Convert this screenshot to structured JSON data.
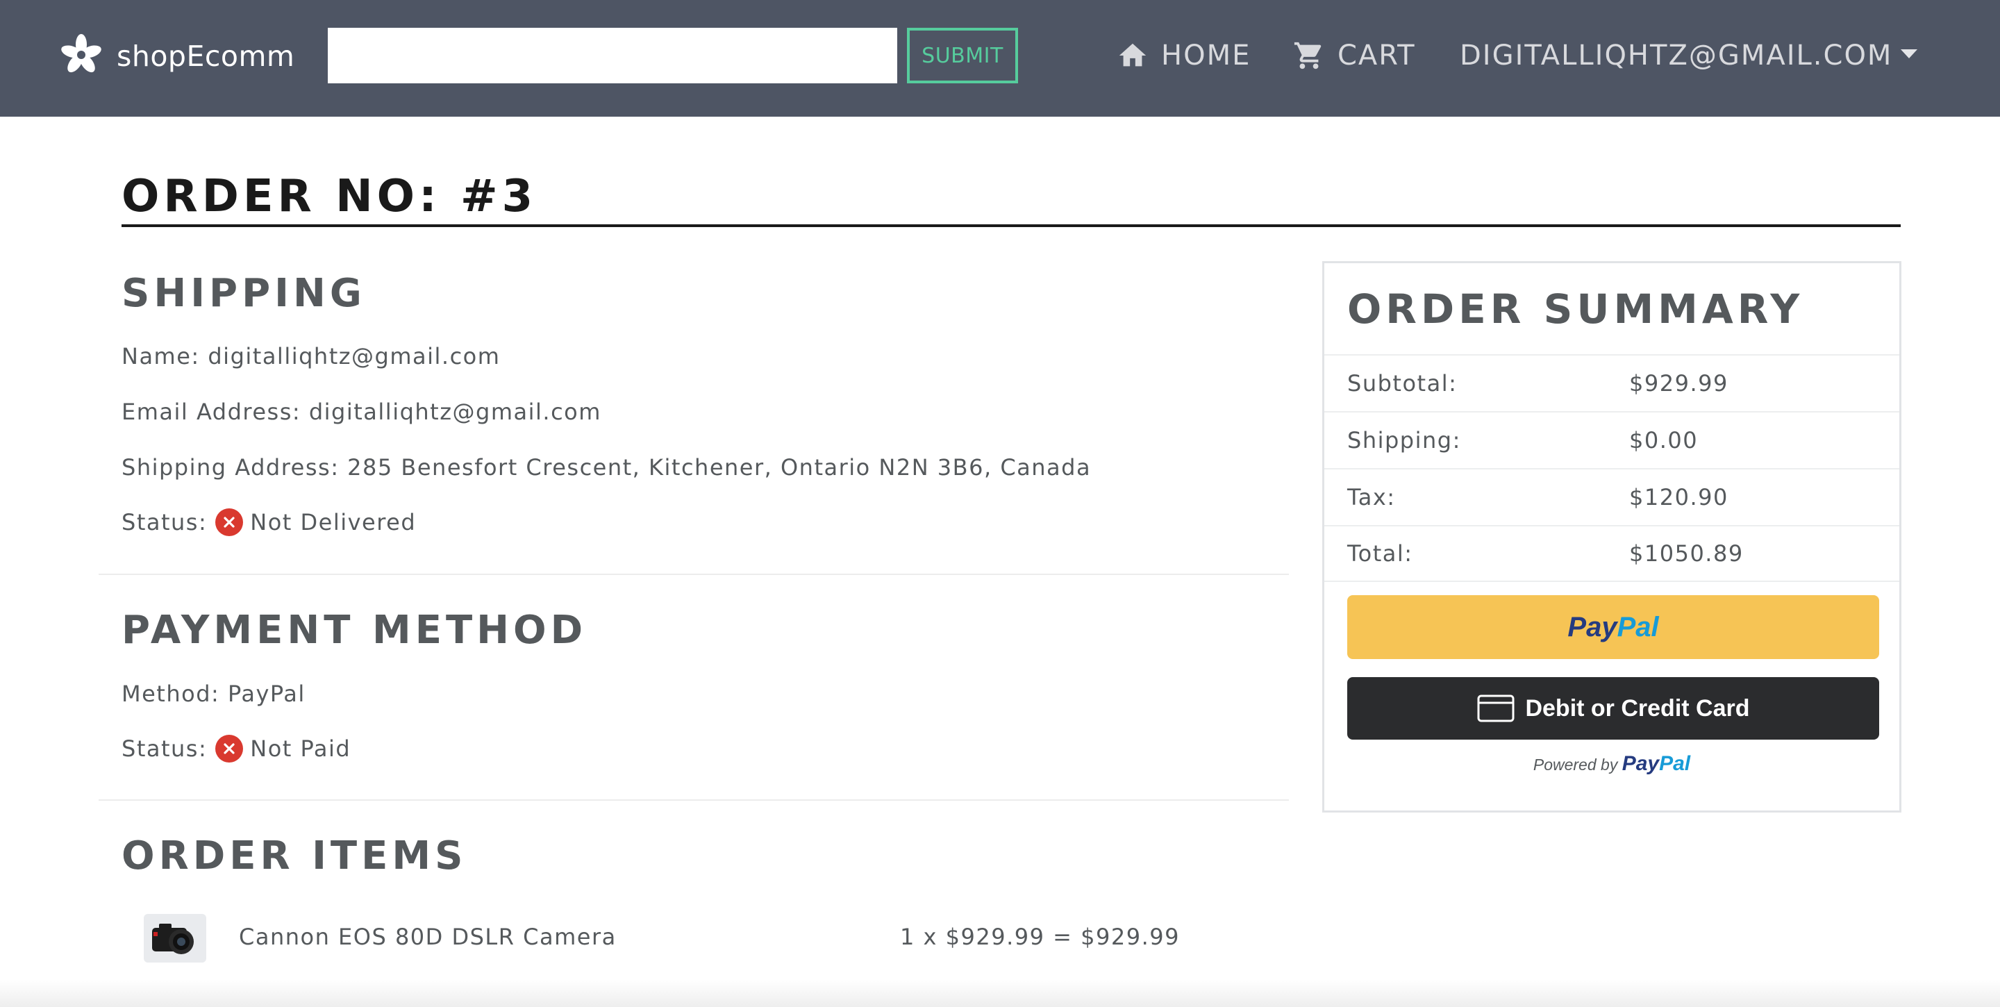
{
  "navbar": {
    "brand": "shopEcomm",
    "search": {
      "value": "",
      "placeholder": ""
    },
    "submit_label": "SUBMIT",
    "links": [
      {
        "label": "HOME",
        "icon": "home-icon"
      },
      {
        "label": "CART",
        "icon": "cart-icon"
      },
      {
        "label": "DIGITALLIQHTZ@GMAIL.COM",
        "icon": "chevron-down-icon"
      }
    ]
  },
  "order": {
    "title": "ORDER NO: #3"
  },
  "shipping": {
    "heading": "SHIPPING",
    "name_line": "Name: digitalliqhtz@gmail.com",
    "email_line": "Email Address: digitalliqhtz@gmail.com",
    "address_line": "Shipping Address: 285 Benesfort Crescent, Kitchener, Ontario N2N 3B6, Canada",
    "status_label": "Status:",
    "status_value": "Not Delivered"
  },
  "payment": {
    "heading": "PAYMENT METHOD",
    "method_line": "Method: PayPal",
    "status_label": "Status:",
    "status_value": "Not Paid"
  },
  "items": {
    "heading": "ORDER ITEMS",
    "list": [
      {
        "name": "Cannon EOS 80D DSLR Camera",
        "price_line": "1 x $929.99 = $929.99"
      }
    ]
  },
  "summary": {
    "title": "ORDER SUMMARY",
    "rows": [
      {
        "label": "Subtotal:",
        "value": "$929.99"
      },
      {
        "label": "Shipping:",
        "value": "$0.00"
      },
      {
        "label": "Tax:",
        "value": "$120.90"
      },
      {
        "label": "Total:",
        "value": "$1050.89"
      }
    ],
    "paypal_button": {
      "pay": "Pay",
      "pal": "Pal"
    },
    "card_button_label": "Debit or Credit Card",
    "powered_by": "Powered by",
    "powered_brand": {
      "pay": "Pay",
      "pal": "Pal"
    }
  },
  "colors": {
    "navbar": "#4e5564",
    "submit": "#56cc9d",
    "error": "#d9392f",
    "paypal_yellow": "#f6c455",
    "card_black": "#2b2c2e"
  }
}
